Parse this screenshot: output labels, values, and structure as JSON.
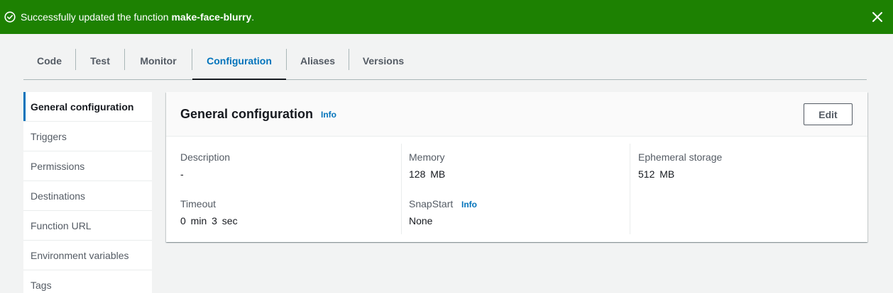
{
  "flash": {
    "message_prefix": "Successfully updated the function ",
    "function_name": "make-face-blurry",
    "message_suffix": ".",
    "icon": "check-circle-icon",
    "close_icon": "close-icon",
    "color": "#1d8102"
  },
  "tabs": [
    {
      "label": "Code",
      "active": false
    },
    {
      "label": "Test",
      "active": false
    },
    {
      "label": "Monitor",
      "active": false
    },
    {
      "label": "Configuration",
      "active": true
    },
    {
      "label": "Aliases",
      "active": false
    },
    {
      "label": "Versions",
      "active": false
    }
  ],
  "sidenav": {
    "items": [
      {
        "label": "General configuration",
        "active": true
      },
      {
        "label": "Triggers",
        "active": false
      },
      {
        "label": "Permissions",
        "active": false
      },
      {
        "label": "Destinations",
        "active": false
      },
      {
        "label": "Function URL",
        "active": false
      },
      {
        "label": "Environment variables",
        "active": false
      },
      {
        "label": "Tags",
        "active": false
      }
    ]
  },
  "panel": {
    "title": "General configuration",
    "info_label": "Info",
    "edit_label": "Edit",
    "fields": {
      "description": {
        "label": "Description",
        "value": "-"
      },
      "timeout": {
        "label": "Timeout",
        "value": "0 min 3 sec"
      },
      "memory": {
        "label": "Memory",
        "value": "128 MB"
      },
      "snapstart": {
        "label": "SnapStart",
        "info_label": "Info",
        "value": "None"
      },
      "ephemeral_storage": {
        "label": "Ephemeral storage",
        "value": "512 MB"
      }
    }
  },
  "colors": {
    "accent": "#0073bb",
    "success": "#1d8102",
    "text": "#16191f",
    "muted": "#545b64"
  }
}
